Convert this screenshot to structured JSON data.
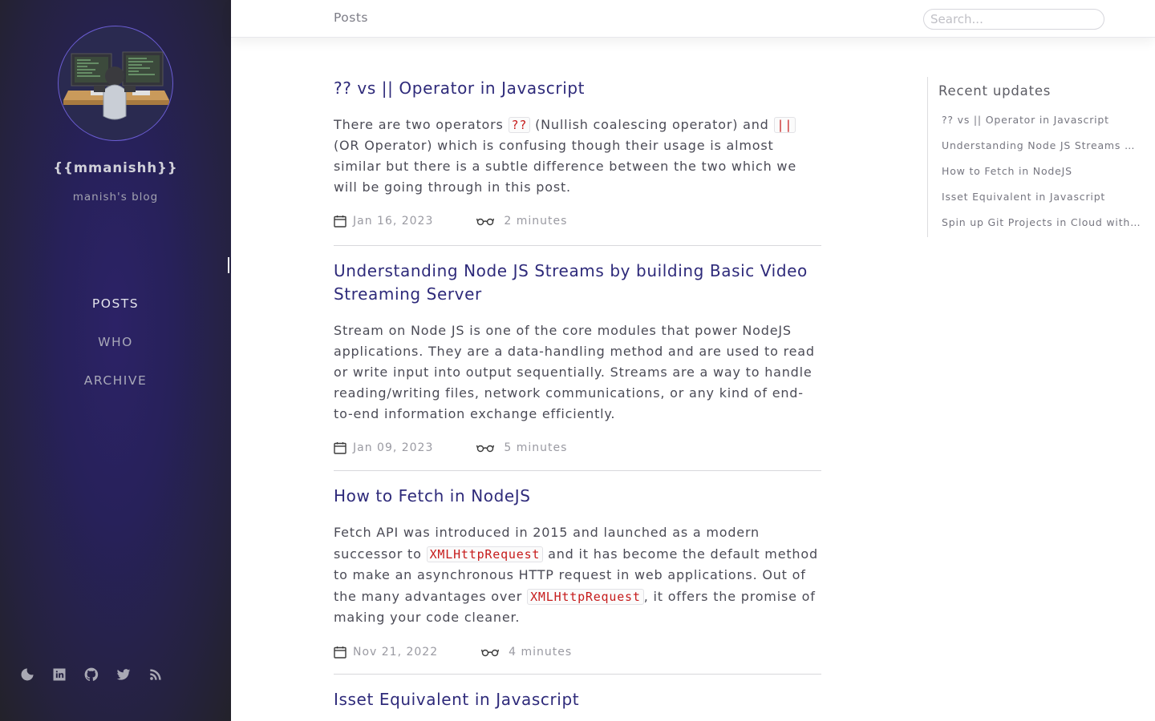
{
  "sidebar": {
    "title": "{{mmanishh}}",
    "subtitle": "manish's blog",
    "nav": [
      {
        "label": "POSTS"
      },
      {
        "label": "WHO"
      },
      {
        "label": "ARCHIVE"
      }
    ],
    "socials": [
      "moon-icon",
      "linkedin-icon",
      "github-icon",
      "twitter-icon",
      "rss-icon"
    ]
  },
  "topbar": {
    "breadcrumb": "Posts",
    "search_placeholder": "Search..."
  },
  "posts": [
    {
      "title": "?? vs || Operator in Javascript",
      "desc": [
        {
          "t": "There are two operators "
        },
        {
          "c": "??"
        },
        {
          "t": " (Nullish coalescing operator) and "
        },
        {
          "c": "||"
        },
        {
          "t": " (OR Operator) which is confusing though their usage is almost similar but there is a subtle difference between the two which we will be going through in this post."
        }
      ],
      "date": "Jan 16, 2023",
      "read_time": "2 minutes"
    },
    {
      "title": "Understanding Node JS Streams by building Basic Video Streaming Server",
      "desc": [
        {
          "t": "Stream on Node JS is one of the core modules that power NodeJS applications. They are a data-handling method and are used to read or write input into output sequentially. Streams are a way to handle reading/writing files, network communications, or any kind of end-to-end information exchange efficiently."
        }
      ],
      "date": "Jan 09, 2023",
      "read_time": "5 minutes"
    },
    {
      "title": "How to Fetch in NodeJS",
      "desc": [
        {
          "t": "Fetch API was introduced in 2015 and launched as a modern successor to "
        },
        {
          "c": "XMLHttpRequest"
        },
        {
          "t": " and it has become the default method to make an asynchronous HTTP request in web applications. Out of the many advantages over "
        },
        {
          "c": "XMLHttpRequest"
        },
        {
          "t": ", it offers the promise of making your code cleaner."
        }
      ],
      "date": "Nov 21, 2022",
      "read_time": "4 minutes"
    },
    {
      "title": "Isset Equivalent in Javascript",
      "desc": [],
      "date": "",
      "read_time": ""
    }
  ],
  "recent": {
    "title": "Recent updates",
    "items": [
      "?? vs || Operator in Javascript",
      "Understanding Node JS Streams by building Basic Video Streaming Server",
      "How to Fetch in NodeJS",
      "Isset Equivalent in Javascript",
      "Spin up Git Projects in Cloud within Seconds"
    ]
  },
  "colors": {
    "sidebar_bg": "#27215a",
    "title_link": "#2e2a7a",
    "code_text": "#c61b1b",
    "avatar_ring": "#6b5dd3"
  }
}
